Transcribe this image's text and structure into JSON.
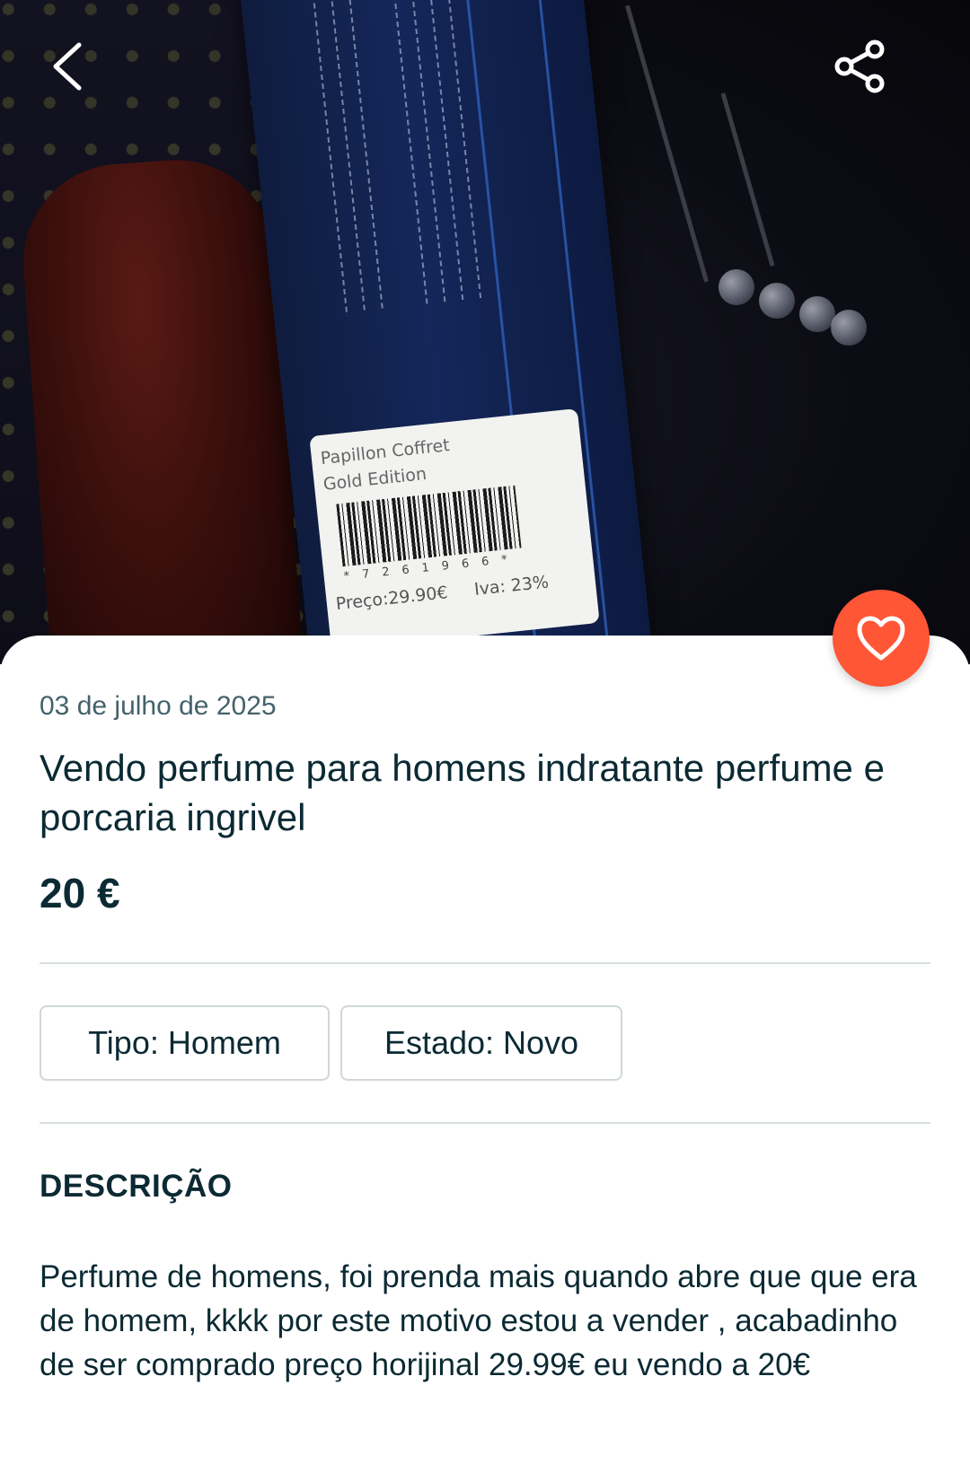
{
  "photo": {
    "label_title": "Papillon Coffret Gold Edition",
    "label_digits": "*7261966*",
    "label_price": "Preço:29.90€",
    "label_iva": "Iva: 23%"
  },
  "header": {
    "back_icon": "chevron-left-icon",
    "share_icon": "share-icon"
  },
  "favorite": {
    "icon": "heart-icon",
    "color": "#ff5636"
  },
  "listing": {
    "date": "03 de julho de 2025",
    "title": "Vendo perfume para homens indratante perfume e porcaria ingrivel",
    "price": "20 €",
    "attributes": [
      {
        "label": "Tipo: Homem"
      },
      {
        "label": "Estado: Novo"
      }
    ],
    "description_heading": "DESCRIÇÃO",
    "description": "Perfume de homens, foi prenda mais quando abre que que era de homem, kkkk por este motivo estou a vender , acabadinho de ser comprado preço horijinal 29.99€ eu vendo a 20€"
  }
}
